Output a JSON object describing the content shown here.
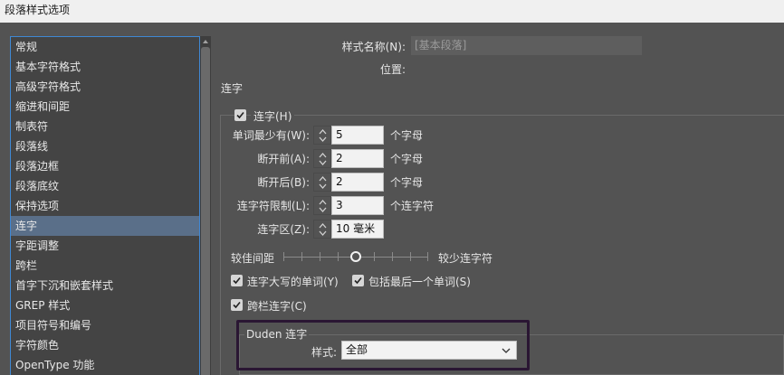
{
  "window": {
    "title": "段落样式选项"
  },
  "sidebar": {
    "items": [
      {
        "label": "常规"
      },
      {
        "label": "基本字符格式"
      },
      {
        "label": "高级字符格式"
      },
      {
        "label": "缩进和间距"
      },
      {
        "label": "制表符"
      },
      {
        "label": "段落线"
      },
      {
        "label": "段落边框"
      },
      {
        "label": "段落底纹"
      },
      {
        "label": "保持选项"
      },
      {
        "label": "连字",
        "selected": true
      },
      {
        "label": "字距调整"
      },
      {
        "label": "跨栏"
      },
      {
        "label": "首字下沉和嵌套样式"
      },
      {
        "label": "GREP 样式"
      },
      {
        "label": "项目符号和编号"
      },
      {
        "label": "字符颜色"
      },
      {
        "label": "OpenType 功能"
      }
    ]
  },
  "header": {
    "style_name_label": "样式名称(N):",
    "style_name_value": "[基本段落]",
    "location_label": "位置:",
    "section_title": "连字"
  },
  "hyphenation": {
    "enable_label": "连字(H)",
    "enabled": true,
    "fields": [
      {
        "label": "单词最少有(W):",
        "value": "5",
        "unit": "个字母"
      },
      {
        "label": "断开前(A):",
        "value": "2",
        "unit": "个字母"
      },
      {
        "label": "断开后(B):",
        "value": "2",
        "unit": "个字母"
      },
      {
        "label": "连字符限制(L):",
        "value": "3",
        "unit": "个连字符"
      },
      {
        "label": "连字区(Z):",
        "value": "10 毫米",
        "unit": ""
      }
    ],
    "slider": {
      "left_label": "较佳间距",
      "right_label": "较少连字符",
      "position_fraction": 0.5
    },
    "options": [
      {
        "label": "连字大写的单词(Y)",
        "checked": true
      },
      {
        "label": "包括最后一个单词(S)",
        "checked": true
      },
      {
        "label": "跨栏连字(C)",
        "checked": true
      }
    ]
  },
  "duden": {
    "title": "Duden 连字",
    "style_label": "样式:",
    "style_value": "全部"
  },
  "colors": {
    "dialog_bg": "#535353",
    "selection": "#5a6f89",
    "focus_border": "#3f88d4",
    "highlight_box": "#2a1633"
  }
}
